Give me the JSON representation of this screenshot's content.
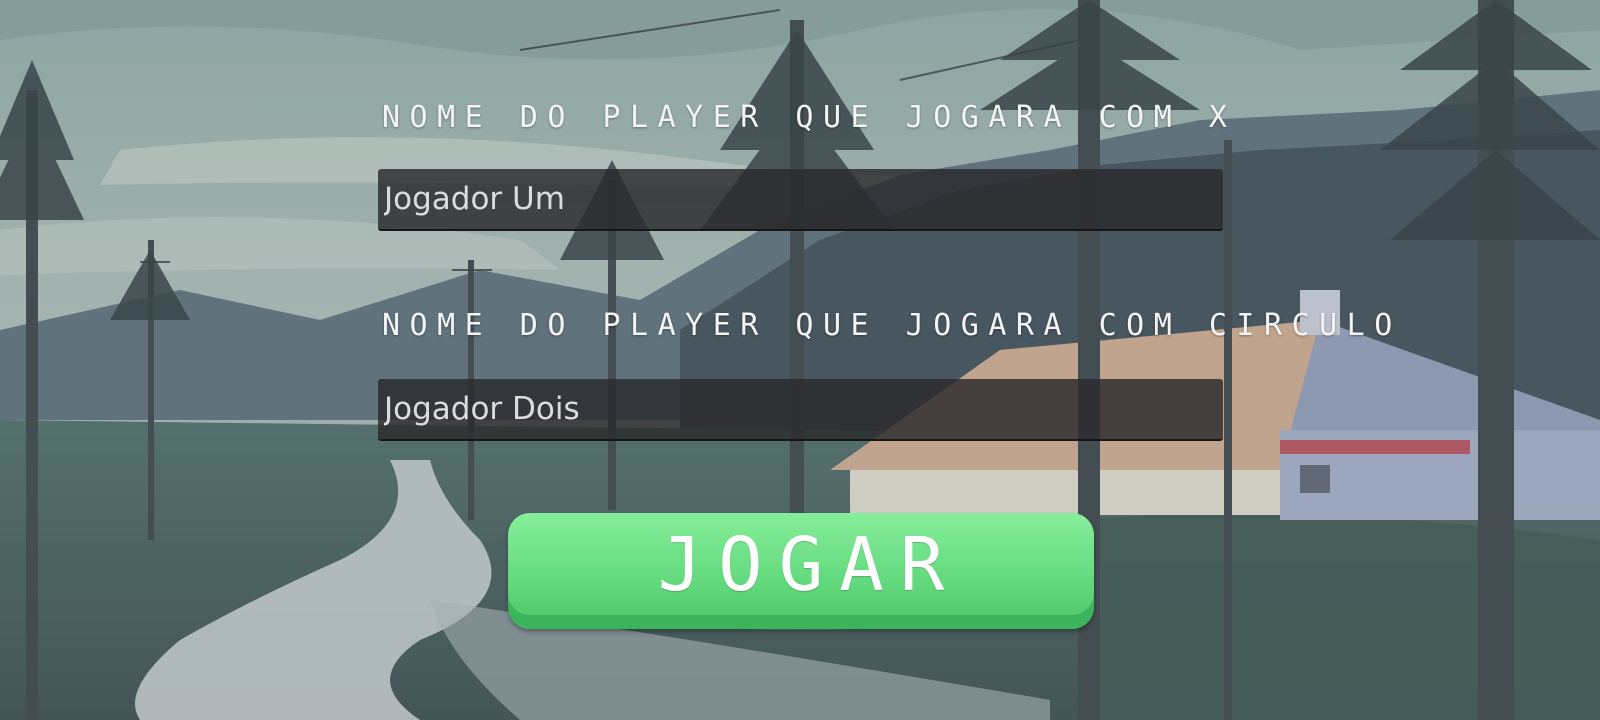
{
  "form": {
    "player_x_label": "NOME DO PLAYER QUE JOGARA COM X",
    "player_x_value": "Jogador Um",
    "player_circle_label": "NOME DO PLAYER QUE JOGARA COM CIRCULO",
    "player_circle_value": "Jogador Dois",
    "play_label": "JOGAR"
  },
  "colors": {
    "play_button": "#6ee083",
    "play_button_shadow": "#3cb45c",
    "field_background": "#2a2a2c",
    "label_text": "#f4f4f4"
  }
}
